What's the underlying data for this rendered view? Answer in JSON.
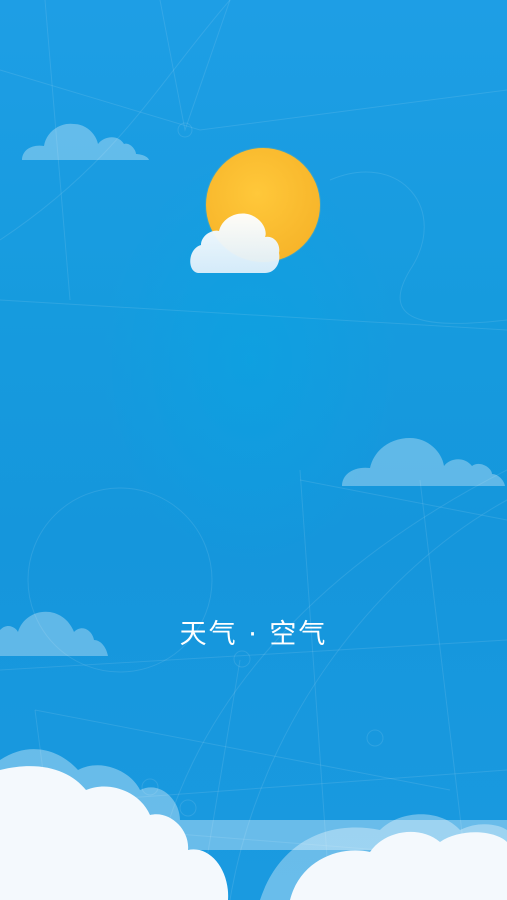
{
  "splash": {
    "slogan": "天气 · 空气"
  },
  "colors": {
    "background_top": "#1e9ee5",
    "background_bottom": "#1a9ae0",
    "sun": "#f9bd2e",
    "cloud_light": "#ffffff",
    "cloud_translucent": "#63b8ea"
  },
  "icons": {
    "logo": "sun-behind-cloud-icon"
  }
}
